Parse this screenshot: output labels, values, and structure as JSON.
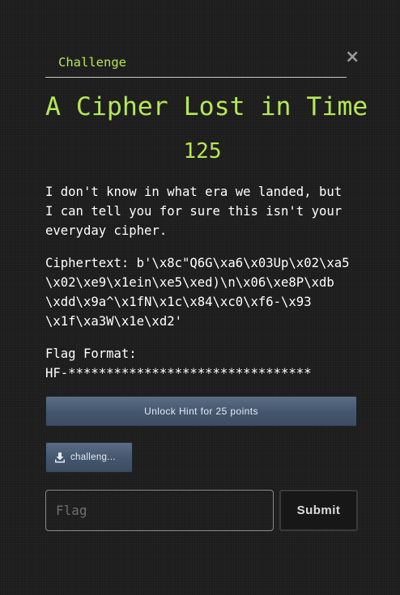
{
  "tabs": {
    "challenge_label": "Challenge"
  },
  "close_label": "×",
  "challenge": {
    "title": "A Cipher Lost in Time",
    "points": "125",
    "description": "I don't know in what era we landed, but\nI can tell you for sure this isn't your\neveryday cipher.",
    "ciphertext_block": "Ciphertext: b'\\x8c\"Q6G\\xa6\\x03Up\\x02\\xa5\n\\x02\\xe9\\x1ein\\xe5\\xed)\\n\\x06\\xe8P\\xdb\n\\xdd\\x9a^\\x1fN\\x1c\\x84\\xc0\\xf6-\\x93\n\\x1f\\xa3W\\x1e\\xd2'",
    "flag_format_block": "Flag Format:\nHF-********************************"
  },
  "hint": {
    "button_label": "Unlock Hint for 25 points"
  },
  "file": {
    "label": "challeng...",
    "icon": "download-icon"
  },
  "flag_form": {
    "placeholder": "Flag",
    "value": "",
    "submit_label": "Submit"
  },
  "colors": {
    "accent": "#b5e853",
    "background": "#1f1f1f",
    "button": "#44566d"
  }
}
